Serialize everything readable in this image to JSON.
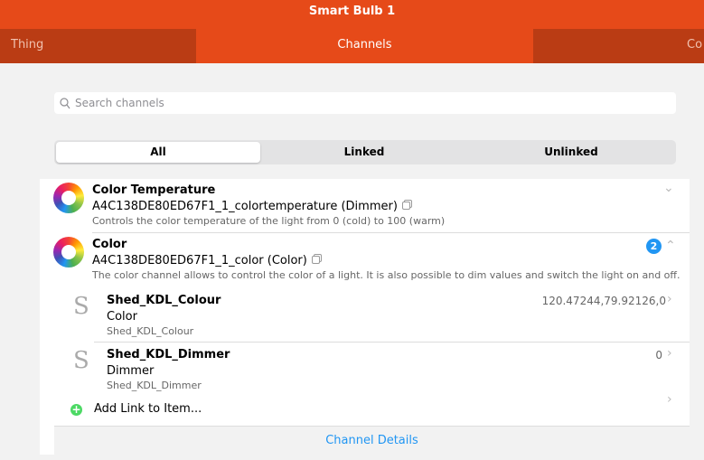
{
  "header": {
    "title": "Smart Bulb 1"
  },
  "tabs": [
    {
      "label": "Thing"
    },
    {
      "label": "Channels"
    },
    {
      "label": "Co"
    }
  ],
  "search": {
    "placeholder": "Search channels"
  },
  "filter": [
    "All",
    "Linked",
    "Unlinked"
  ],
  "channels": [
    {
      "title": "Color Temperature",
      "id": "A4C138DE80ED67F1_1_colortemperature (Dimmer)",
      "desc": "Controls the color temperature of the light from 0 (cold) to 100 (warm)"
    },
    {
      "title": "Color",
      "id": "A4C138DE80ED67F1_1_color (Color)",
      "desc": "The color channel allows to control the color of a light. It is also possible to dim values and switch the light on and off.",
      "badge": "2"
    }
  ],
  "items": [
    {
      "letter": "S",
      "name": "Shed_KDL_Colour",
      "type": "Color",
      "label": "Shed_KDL_Colour",
      "state": "120.47244,79.92126,0"
    },
    {
      "letter": "S",
      "name": "Shed_KDL_Dimmer",
      "type": "Dimmer",
      "label": "Shed_KDL_Dimmer",
      "state": "0"
    }
  ],
  "add_link": "Add Link to Item...",
  "details": "Channel Details",
  "colors": {
    "accent": "#e64a19",
    "badge": "#2196f3",
    "link": "#2196f3",
    "add": "#4cd964"
  }
}
